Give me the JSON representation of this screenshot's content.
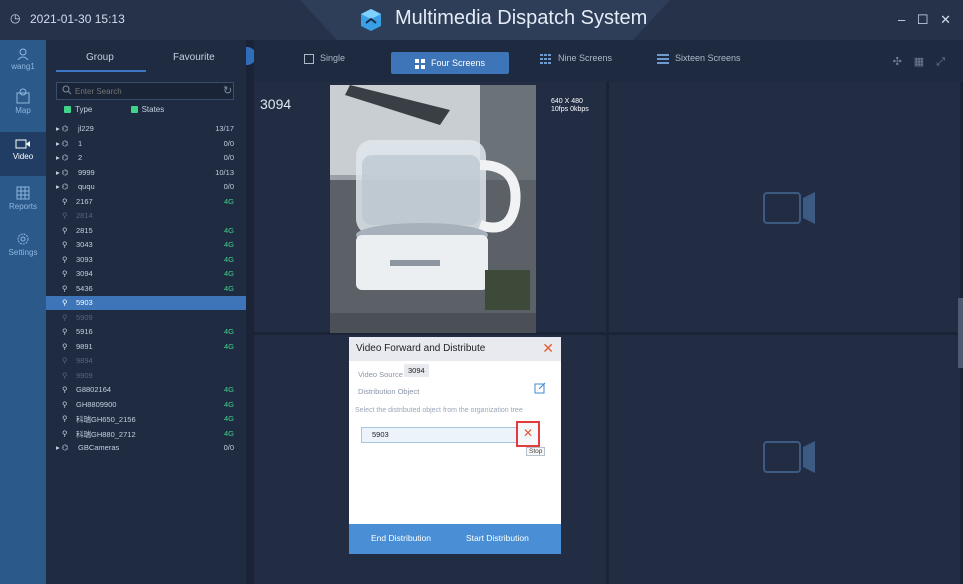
{
  "header": {
    "datetime": "2021-01-30 15:13",
    "title": "Multimedia Dispatch System",
    "window_controls": "– ☐ ✕"
  },
  "user": {
    "name": "wang1"
  },
  "nav": [
    {
      "label": "Map",
      "icon": "map-icon"
    },
    {
      "label": "Video",
      "icon": "video-icon"
    },
    {
      "label": "Reports",
      "icon": "reports-icon"
    },
    {
      "label": "Settings",
      "icon": "settings-icon"
    }
  ],
  "panel": {
    "tabs": [
      "Group",
      "Favourite"
    ],
    "search_placeholder": "Enter Search",
    "filters": {
      "type": "Type",
      "states": "States"
    },
    "tree": [
      {
        "label": "jl229",
        "count": "13/17",
        "kind": "group",
        "tone": "white"
      },
      {
        "label": "1",
        "count": "0/0",
        "kind": "group",
        "tone": "white"
      },
      {
        "label": "2",
        "count": "0/0",
        "kind": "group",
        "tone": "white"
      },
      {
        "label": "9999",
        "count": "10/13",
        "kind": "group",
        "tone": "white"
      },
      {
        "label": "ququ",
        "count": "0/0",
        "kind": "group",
        "tone": "white"
      },
      {
        "label": "2167",
        "count": "4G",
        "kind": "user",
        "tone": "white"
      },
      {
        "label": "2814",
        "count": "",
        "kind": "user",
        "tone": "dim"
      },
      {
        "label": "2815",
        "count": "4G",
        "kind": "user",
        "tone": "white"
      },
      {
        "label": "3043",
        "count": "4G",
        "kind": "user",
        "tone": "white"
      },
      {
        "label": "3093",
        "count": "4G",
        "kind": "user",
        "tone": "white"
      },
      {
        "label": "3094",
        "count": "4G",
        "kind": "user",
        "tone": "white"
      },
      {
        "label": "5436",
        "count": "4G",
        "kind": "user",
        "tone": "white"
      },
      {
        "label": "5903",
        "count": "",
        "kind": "user",
        "tone": "selected"
      },
      {
        "label": "5909",
        "count": "",
        "kind": "user",
        "tone": "dim"
      },
      {
        "label": "5916",
        "count": "4G",
        "kind": "user",
        "tone": "white"
      },
      {
        "label": "9891",
        "count": "4G",
        "kind": "user",
        "tone": "white"
      },
      {
        "label": "9894",
        "count": "",
        "kind": "user",
        "tone": "dim"
      },
      {
        "label": "9909",
        "count": "",
        "kind": "user",
        "tone": "dim"
      },
      {
        "label": "G8802164",
        "count": "4G",
        "kind": "user",
        "tone": "white"
      },
      {
        "label": "GH8809900",
        "count": "4G",
        "kind": "user",
        "tone": "white"
      },
      {
        "label": "科瑞GH650_2156",
        "count": "4G",
        "kind": "user",
        "tone": "white"
      },
      {
        "label": "科瑞GH880_2712",
        "count": "4G",
        "kind": "user",
        "tone": "white"
      },
      {
        "label": "GBCameras",
        "count": "0/0",
        "kind": "group",
        "tone": "white"
      }
    ]
  },
  "layout_tabs": [
    "Single",
    "Four Screens",
    "Nine Screens",
    "Sixteen Screens"
  ],
  "active_layout": "Four Screens",
  "screen": {
    "label": "3094",
    "resolution": "640 X 480",
    "stats": "10fps 0kbps"
  },
  "dialog": {
    "title": "Video Forward and Distribute",
    "source_label": "Video Source",
    "source_value": "3094",
    "object_label": "Distribution Object",
    "hint": "Select the distributed object from the organization tree",
    "item": "5903",
    "tooltip": "Stop",
    "end_btn": "End Distribution",
    "start_btn": "Start Distribution"
  },
  "colors": {
    "accent": "#3e74b8",
    "sidebar": "#2b5a8a",
    "status_green": "#3fd48a",
    "danger": "#e23b3b"
  }
}
